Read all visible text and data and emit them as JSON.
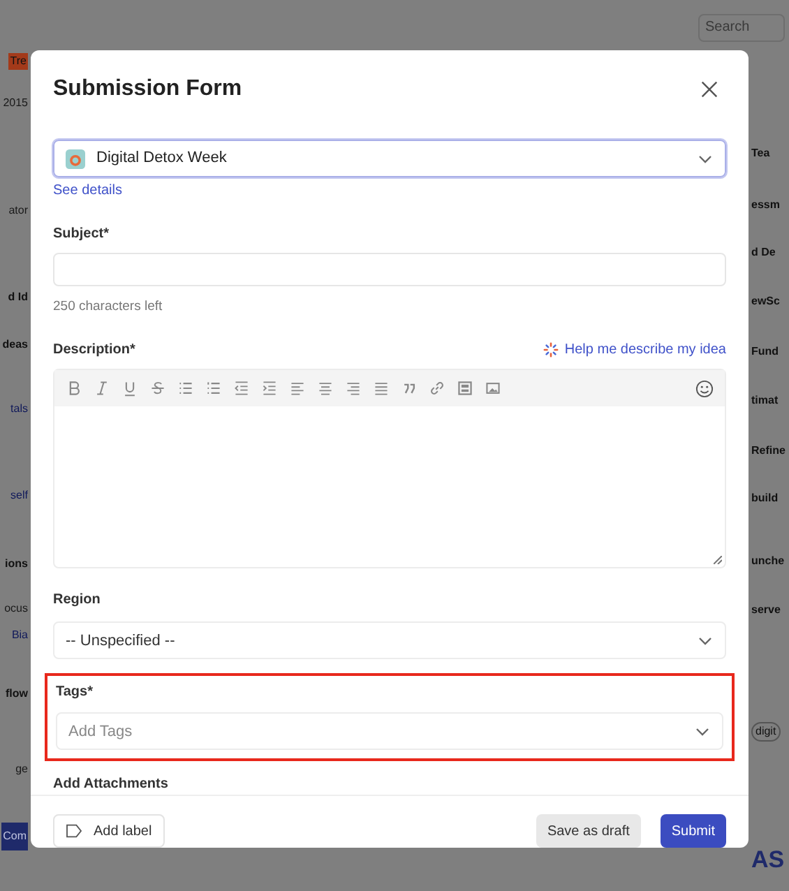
{
  "background": {
    "search": {
      "placeholder": "Search"
    },
    "left_fragments": [
      {
        "kind": "badge",
        "text": "Tre"
      },
      {
        "kind": "text",
        "text": "2015"
      },
      {
        "kind": "text",
        "text": "ator"
      },
      {
        "kind": "bold",
        "text": "d Id"
      },
      {
        "kind": "bold",
        "text": "deas"
      },
      {
        "kind": "link",
        "text": "tals"
      },
      {
        "kind": "link",
        "text": "self"
      },
      {
        "kind": "bold",
        "text": "ions"
      },
      {
        "kind": "text",
        "text": "ocus"
      },
      {
        "kind": "link",
        "text": "Bia"
      },
      {
        "kind": "bold",
        "text": "flow"
      },
      {
        "kind": "text",
        "text": "ge"
      },
      {
        "kind": "button",
        "text": "Com"
      }
    ],
    "right_fragments": [
      {
        "kind": "bold",
        "text": "Tea"
      },
      {
        "kind": "bold",
        "text": "essm"
      },
      {
        "kind": "bold",
        "text": "d De"
      },
      {
        "kind": "bold",
        "text": "ewSc"
      },
      {
        "kind": "bold",
        "text": "Fund"
      },
      {
        "kind": "bold",
        "text": "timat"
      },
      {
        "kind": "bold",
        "text": "Refine"
      },
      {
        "kind": "bold",
        "text": "build"
      },
      {
        "kind": "bold",
        "text": "unche"
      },
      {
        "kind": "bold",
        "text": "serve"
      },
      {
        "kind": "chip",
        "text": "digit"
      },
      {
        "kind": "logo",
        "text": "AS"
      }
    ]
  },
  "modal": {
    "title": "Submission Form",
    "campaign": {
      "value": "Digital Detox Week",
      "link": "See details"
    },
    "subject": {
      "label": "Subject*",
      "hint": "250 characters left"
    },
    "description": {
      "label": "Description*",
      "help": "Help me describe my idea"
    },
    "region": {
      "label": "Region",
      "value": "-- Unspecified --"
    },
    "tags": {
      "label": "Tags*",
      "placeholder": "Add Tags",
      "highlighted": true
    },
    "attachments": {
      "label": "Add Attachments"
    },
    "footer": {
      "add_label": "Add label",
      "draft": "Save as draft",
      "submit": "Submit"
    }
  }
}
